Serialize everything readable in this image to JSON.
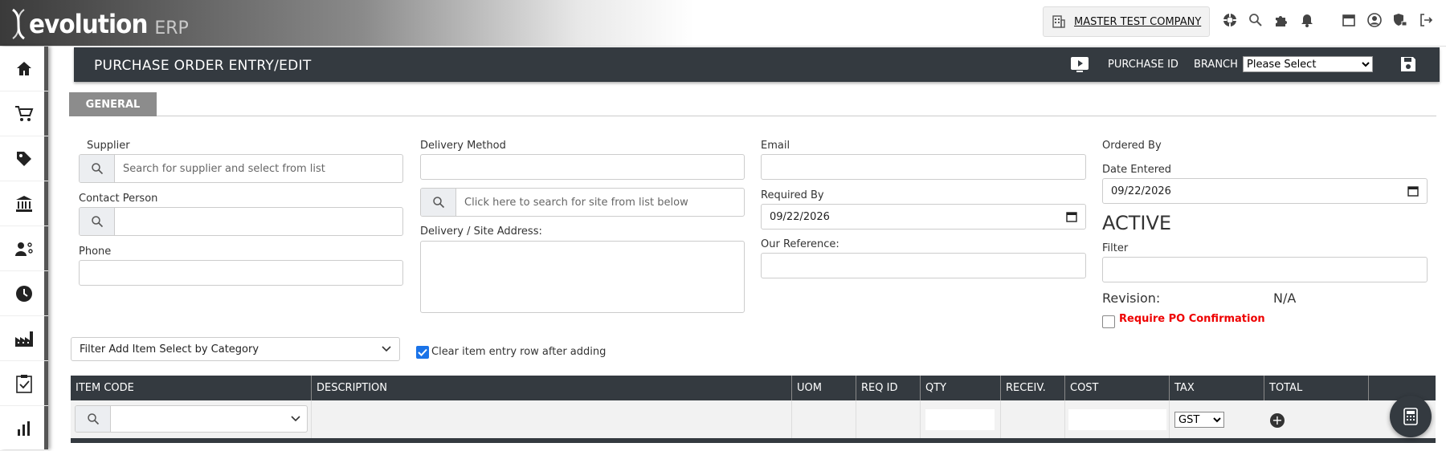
{
  "app": {
    "logo_main": "evolution",
    "logo_sub": "ERP"
  },
  "topbar": {
    "company": "MASTER TEST COMPANY"
  },
  "sidebar": {
    "items": [
      "home-icon",
      "cart-icon",
      "tag-icon",
      "bank-icon",
      "users-icon",
      "clock-icon",
      "factory-icon",
      "clipboard-check-icon",
      "chart-icon"
    ]
  },
  "header": {
    "title": "PURCHASE ORDER ENTRY/EDIT",
    "purchase_id_label": "PURCHASE ID",
    "branch_label": "BRANCH",
    "branch_value": "Please Select"
  },
  "tabs": [
    {
      "label": "GENERAL"
    }
  ],
  "form": {
    "supplier_label": "Supplier",
    "supplier_placeholder": "Search for supplier and select from list",
    "contact_label": "Contact Person",
    "phone_label": "Phone",
    "delivery_method_label": "Delivery Method",
    "site_search_placeholder": "Click here to search for site from list below",
    "delivery_address_label": "Delivery / Site Address:",
    "email_label": "Email",
    "required_by_label": "Required By",
    "required_by_value": "09/22/2026",
    "our_reference_label": "Our Reference:",
    "ordered_by_label": "Ordered By",
    "date_entered_label": "Date Entered",
    "date_entered_value": "09/22/2026",
    "status": "ACTIVE",
    "filter_label": "Filter",
    "revision_label": "Revision:",
    "revision_value": "N/A",
    "require_confirm_label": "Require PO Confirmation",
    "category_filter": "Filter Add Item Select by Category",
    "clear_row_label": "Clear item entry row after adding"
  },
  "table": {
    "columns": [
      "ITEM CODE",
      "DESCRIPTION",
      "UOM",
      "REQ ID",
      "QTY",
      "RECEIV.",
      "COST",
      "TAX",
      "TOTAL"
    ],
    "tax_value": "GST"
  },
  "colors": {
    "header_bg": "#343a40",
    "tab_bg": "#8c8c8c",
    "required": "#ee0000",
    "checkbox": "#1a73e8"
  }
}
